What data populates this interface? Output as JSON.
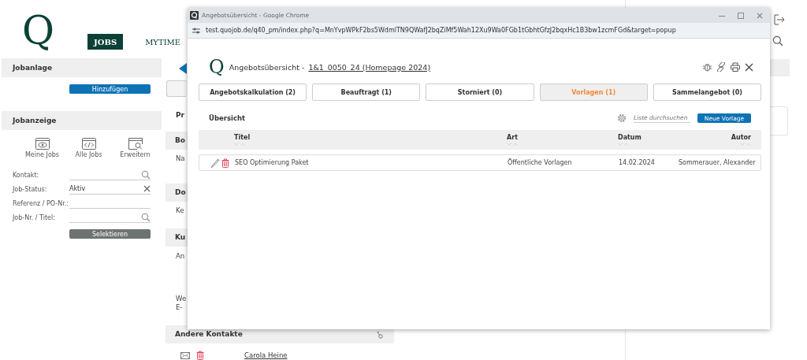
{
  "app": {
    "logo": "Q",
    "nav": [
      {
        "label": "JOBS",
        "selected": true
      },
      {
        "label": "MYTIME",
        "selected": false
      }
    ]
  },
  "sidebar": {
    "jobanlage": {
      "title": "Jobanlage",
      "button": "Hinzufügen"
    },
    "jobanzeige": {
      "title": "Jobanzeige",
      "views": [
        {
          "label": "Meine Jobs",
          "kind": "eye"
        },
        {
          "label": "Alle Jobs",
          "kind": "code"
        },
        {
          "label": "Erweitern",
          "kind": "search"
        }
      ],
      "fields": [
        {
          "label": "Kontakt:",
          "kind": "search"
        },
        {
          "label": "Job-Status:",
          "value": "Aktiv",
          "kind": "clear"
        },
        {
          "label": "Referenz / PO-Nr.:",
          "kind": "plain"
        },
        {
          "label": "Job-Nr. / Titel:",
          "kind": "search"
        }
      ],
      "button": "Selektieren"
    }
  },
  "main": {
    "lines": [
      {
        "kind": "label",
        "text": "Pr"
      },
      {
        "kind": "header",
        "text": "Bo"
      },
      {
        "kind": "text",
        "text": "Na"
      },
      {
        "kind": "header",
        "text": "Do"
      },
      {
        "kind": "text",
        "text": "Ke"
      },
      {
        "kind": "header",
        "text": "Ku"
      },
      {
        "kind": "text",
        "text": "An"
      },
      {
        "kind": "text",
        "text": "We"
      },
      {
        "kind": "text",
        "text": "E-"
      }
    ],
    "contacts_section": {
      "title": "Andere Kontakte",
      "contacts": [
        {
          "name": "Carola Heine"
        }
      ]
    }
  },
  "popup": {
    "window_title": "Angebotsübersicht - Google Chrome",
    "url": "test.quojob.de/q40_pm/index.php?q=MnYvpWPkF2bs5WdmlTN9QWafJ2bqZiMf5Wah12Xu9Wa0FGb1tGbhtGfzJ2bqxHc1B3bw1zcmFGd&target=popup",
    "logo": "Q",
    "title": "Angebotsübersicht -",
    "title_link": "1&1_0050_24 (Homepage 2024)",
    "tabs": [
      {
        "label": "Angebotskalkulation (2)",
        "selected": false
      },
      {
        "label": "Beauftragt (1)",
        "selected": false
      },
      {
        "label": "Storniert (0)",
        "selected": false
      },
      {
        "label": "Vorlagen (1)",
        "selected": true
      },
      {
        "label": "Sammelangebot (0)",
        "selected": false
      }
    ],
    "section_title": "Übersicht",
    "search": {
      "placeholder": "Liste durchsuchen"
    },
    "new_button": "Neue Vorlage",
    "table": {
      "columns": [
        {
          "label": "Titel"
        },
        {
          "label": "Art"
        },
        {
          "label": "Datum"
        },
        {
          "label": "Autor"
        }
      ],
      "rows": [
        {
          "cells": [
            "SEO Optimierung Paket",
            "Öffentliche Vorlagen",
            "14.02.2024",
            "Sommerauer, Alexander"
          ]
        }
      ]
    }
  }
}
